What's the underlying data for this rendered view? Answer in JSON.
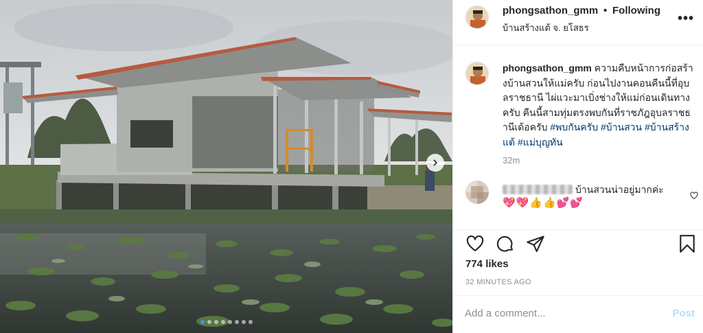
{
  "post": {
    "username": "phongsathon_gmm",
    "separator": "•",
    "follow_status": "Following",
    "location": "บ้านสร้างแต้ จ. ยโสธร",
    "more_label": "•••",
    "caption_text": "ความคืบหน้าการก่อสร้างบ้านสวนให้แม่ครับ ก่อนไปงานคอนคืนนี้ที่อุบลราชธานี ไผ่แวะมาเบิ่งช่างให้แม่ก่อนเดินทางครับ คืนนี้สามทุ่มตรงพบกันที่ราชภัฎอุบลราชธานีเด้อครับ",
    "hashtags": [
      "#พบกันครับ",
      "#บ้านสวน",
      "#บ้านสร้างแต้",
      "#แม่บุญทัน"
    ],
    "time_ago": "32m",
    "likes": "774 likes",
    "posted": "32 MINUTES AGO",
    "photo_count": 8,
    "active_photo": 1
  },
  "comment": {
    "text": "บ้านสวนน่าอยู่มากค่ะ",
    "emoji": "💖💖👍👍💕💕"
  },
  "add_comment": {
    "placeholder": "Add a comment...",
    "post_label": "Post"
  },
  "colors": {
    "accent": "#3897f0",
    "hashtag": "#00376b",
    "post_disabled": "#b2dffc",
    "muted": "#8e8e8e",
    "roof": "#b85a3e"
  },
  "icons": {
    "like": "heart-icon",
    "comment": "comment-icon",
    "share": "paper-plane-icon",
    "save": "bookmark-icon",
    "more": "more-options-icon",
    "next": "chevron-right-icon"
  }
}
